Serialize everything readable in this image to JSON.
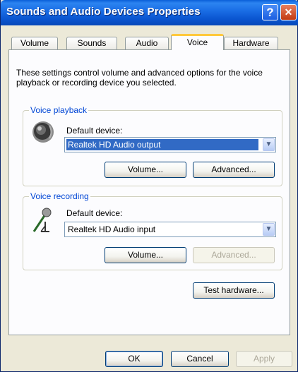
{
  "window": {
    "title": "Sounds and Audio Devices Properties",
    "help_glyph": "?",
    "close_glyph": "✕"
  },
  "tabs": [
    {
      "label": "Volume",
      "active": false
    },
    {
      "label": "Sounds",
      "active": false
    },
    {
      "label": "Audio",
      "active": false
    },
    {
      "label": "Voice",
      "active": true
    },
    {
      "label": "Hardware",
      "active": false
    }
  ],
  "description": "These settings control volume and advanced options for the voice playback or recording device you selected.",
  "voice_playback": {
    "legend": "Voice playback",
    "icon": "speaker-icon",
    "default_device_label": "Default device:",
    "device_value": "Realtek HD Audio output",
    "volume_button": "Volume...",
    "advanced_button": "Advanced...",
    "advanced_enabled": true
  },
  "voice_recording": {
    "legend": "Voice recording",
    "icon": "microphone-icon",
    "default_device_label": "Default device:",
    "device_value": "Realtek HD Audio input",
    "volume_button": "Volume...",
    "advanced_button": "Advanced...",
    "advanced_enabled": false
  },
  "test_hardware_button": "Test hardware...",
  "footer": {
    "ok": "OK",
    "cancel": "Cancel",
    "apply": "Apply",
    "apply_enabled": false
  },
  "colors": {
    "title_bar": "#0a5fd8",
    "active_tab_highlight": "#ffc83c",
    "group_legend": "#0046d5",
    "selection": "#316ac5"
  }
}
